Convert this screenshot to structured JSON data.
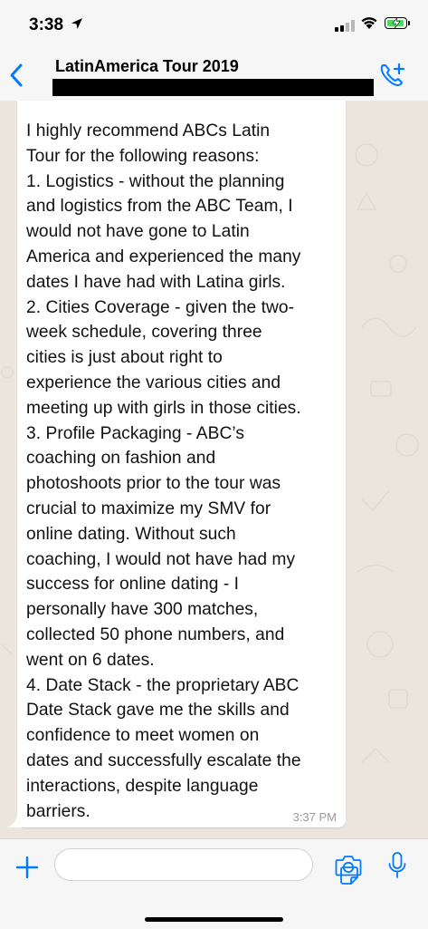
{
  "status_bar": {
    "time": "3:38",
    "icons": [
      "location-arrow-icon",
      "cellular-signal-icon",
      "wifi-icon",
      "battery-charging-icon"
    ]
  },
  "header": {
    "chat_name": "LatinAmerica Tour 2019",
    "back_icon": "chevron-left-icon",
    "call_icon": "add-call-icon"
  },
  "message": {
    "text": "I highly recommend ABCs Latin\nTour for the following reasons:\n1. Logistics - without the planning\nand logistics from the ABC Team, I\nwould not have gone to Latin\nAmerica and experienced the many\ndates I have had with Latina girls.\n2. Cities Coverage - given the two-\nweek schedule, covering three\ncities is just about right to\nexperience the various cities and\nmeeting up with girls in those cities.\n3. Profile Packaging - ABC’s\ncoaching on fashion and\nphotoshoots prior to the tour was\ncrucial to maximize my SMV for\nonline dating.  Without such\ncoaching, I would not have had my\nsuccess for online dating - I\npersonally have 300 matches,\ncollected 50 phone numbers, and\nwent on 6 dates.\n4. Date Stack - the proprietary ABC\nDate Stack gave me the skills and\nconfidence to meet women on\ndates and successfully escalate the\ninteractions, despite language\nbarriers.",
    "timestamp": "3:37 PM"
  },
  "input_bar": {
    "placeholder": "",
    "icons": [
      "plus-icon",
      "sticker-icon",
      "camera-icon",
      "microphone-icon"
    ]
  },
  "colors": {
    "accent": "#007aff",
    "chat_background": "#ece5dd",
    "bubble": "#ffffff",
    "bar": "#f6f6f6",
    "battery": "#4cd964"
  }
}
